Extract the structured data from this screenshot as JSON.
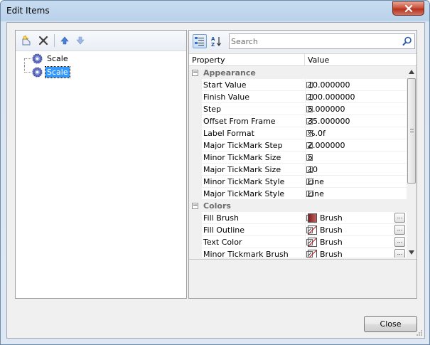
{
  "window": {
    "title": "Edit Items"
  },
  "tree": {
    "items": [
      {
        "label": "Scale",
        "selected": false
      },
      {
        "label": "Scale",
        "selected": true
      }
    ]
  },
  "property_grid": {
    "search": {
      "placeholder": "Search"
    },
    "headers": {
      "property": "Property",
      "value": "Value"
    },
    "categories": [
      {
        "label": "Appearance",
        "properties": [
          {
            "name": "Start Value",
            "value": "10.000000"
          },
          {
            "name": "Finish Value",
            "value": "100.000000"
          },
          {
            "name": "Step",
            "value": "5.000000"
          },
          {
            "name": "Offset From Frame",
            "value": "35.000000"
          },
          {
            "name": "Label Format",
            "value": "%.0f"
          },
          {
            "name": "Major TickMark Step",
            "value": "2.000000"
          },
          {
            "name": "Minor TickMark Size",
            "value": "5"
          },
          {
            "name": "Major TickMark Size",
            "value": "10"
          },
          {
            "name": "Minor TickMark Style",
            "value": "Line"
          },
          {
            "name": "Major TickMark Style",
            "value": "Line"
          }
        ]
      },
      {
        "label": "Colors",
        "properties": [
          {
            "name": "Fill Brush",
            "value": "Brush",
            "swatch": "#a52a2a"
          },
          {
            "name": "Fill Outline",
            "value": "Brush",
            "swatch": "none"
          },
          {
            "name": "Text Color",
            "value": "Brush",
            "swatch": "none"
          },
          {
            "name": "Minor Tickmark Brush",
            "value": "Brush",
            "swatch": "none"
          }
        ]
      }
    ],
    "ellipsis": "..."
  },
  "buttons": {
    "close": "Close"
  },
  "colors": {
    "selection": "#3399ff",
    "fill_brush_swatch": "#a52a2a"
  }
}
